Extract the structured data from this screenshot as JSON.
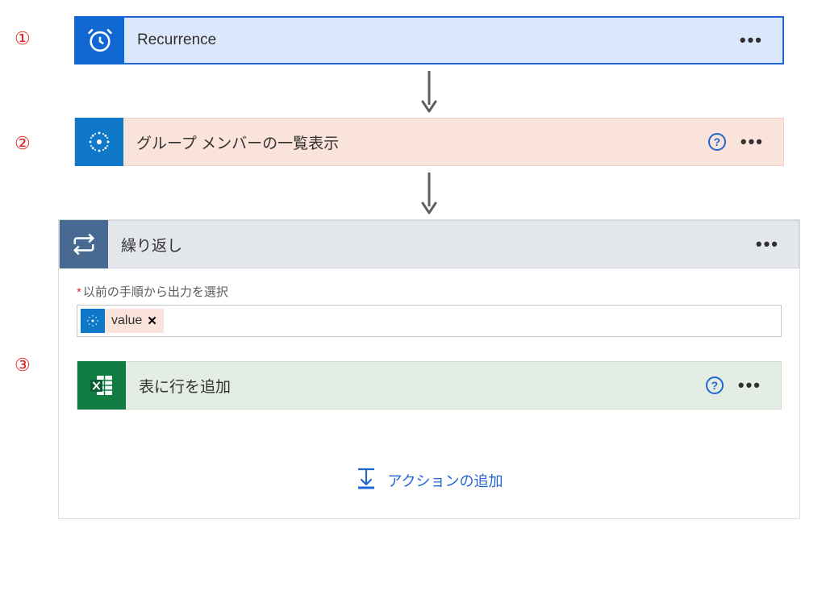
{
  "annotations": {
    "a1": "①",
    "a2": "②",
    "a3": "③"
  },
  "steps": {
    "recurrence": {
      "title": "Recurrence"
    },
    "listMembers": {
      "title": "グループ メンバーの一覧表示"
    },
    "loop": {
      "title": "繰り返し",
      "fieldLabel": "以前の手順から出力を選択",
      "token": "value"
    },
    "addRow": {
      "title": "表に行を追加"
    }
  },
  "actions": {
    "addAction": "アクションの追加"
  }
}
